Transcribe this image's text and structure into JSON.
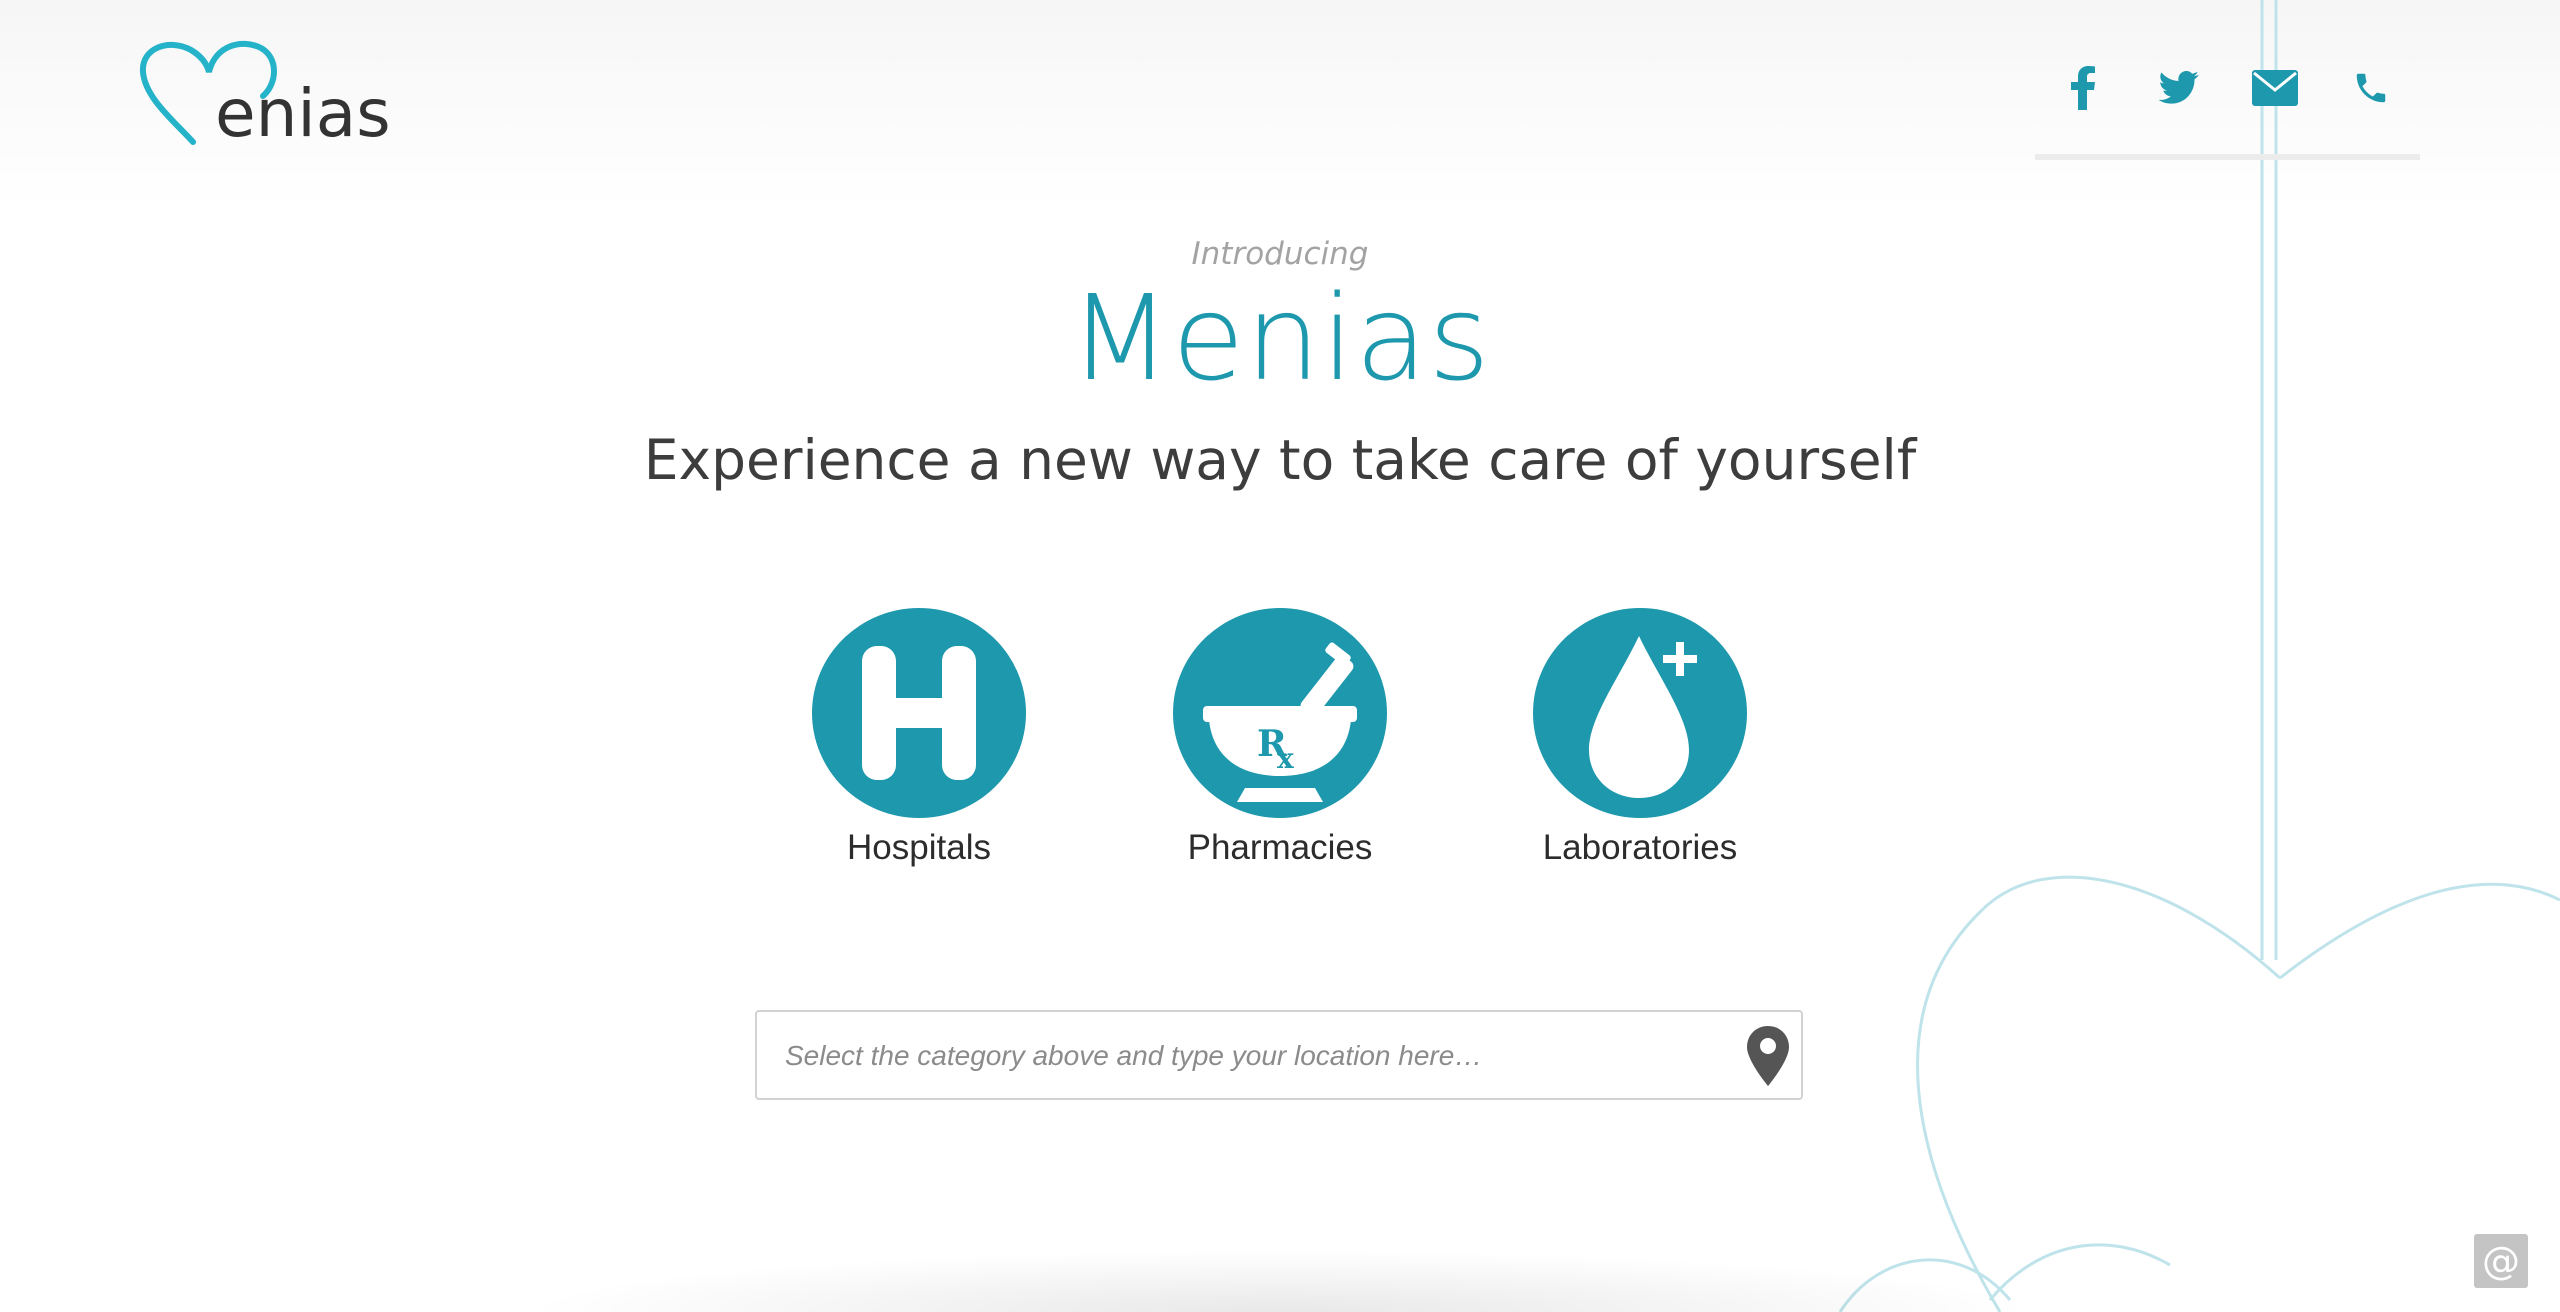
{
  "header": {
    "logo_text": "enias",
    "social": [
      {
        "name": "facebook",
        "icon": "facebook-icon"
      },
      {
        "name": "twitter",
        "icon": "twitter-icon"
      },
      {
        "name": "email",
        "icon": "envelope-icon"
      },
      {
        "name": "phone",
        "icon": "phone-icon"
      }
    ]
  },
  "hero": {
    "intro": "Introducing",
    "title": "Menias",
    "tagline": "Experience a new way to take care of yourself"
  },
  "categories": [
    {
      "label": "Hospitals",
      "icon": "hospital-h-icon"
    },
    {
      "label": "Pharmacies",
      "icon": "mortar-pestle-rx-icon"
    },
    {
      "label": "Laboratories",
      "icon": "blood-drop-plus-icon"
    }
  ],
  "search": {
    "placeholder": "Select the category above and type your location here…",
    "icon": "location-pin-icon"
  },
  "footer": {
    "contact_symbol": "@"
  },
  "colors": {
    "accent": "#1e98ad",
    "logo_heart": "#24b3c8",
    "text_dark": "#3d3d3d",
    "muted": "#a3a3a3"
  }
}
